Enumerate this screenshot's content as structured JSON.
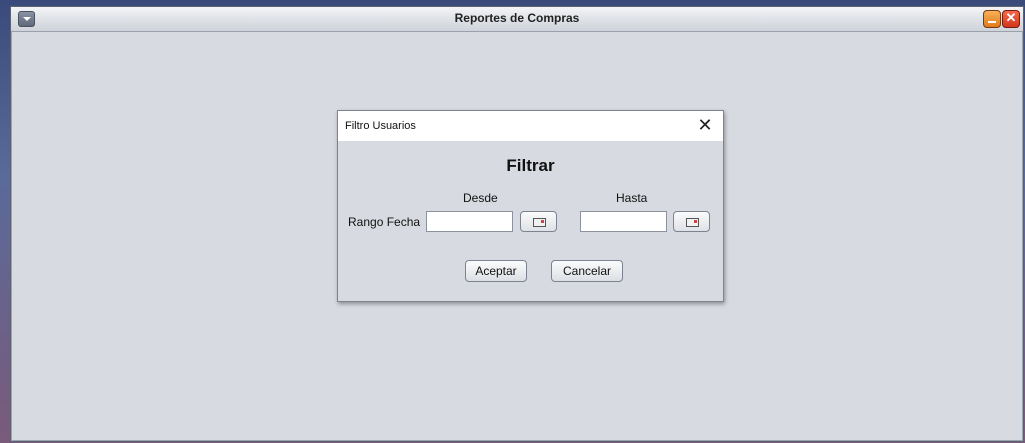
{
  "window": {
    "title": "Reportes de Compras",
    "close_glyph": "✕"
  },
  "dialog": {
    "title": "Filtro Usuarios",
    "close_glyph": "✕",
    "heading": "Filtrar",
    "range_label": "Rango Fecha",
    "from_label": "Desde",
    "to_label": "Hasta",
    "from_value": "",
    "to_value": "",
    "accept_label": "Aceptar",
    "cancel_label": "Cancelar"
  },
  "icons": {
    "system_menu": "chevron-down-icon",
    "minimize": "minimize-icon",
    "close": "close-icon",
    "calendar": "calendar-icon"
  }
}
